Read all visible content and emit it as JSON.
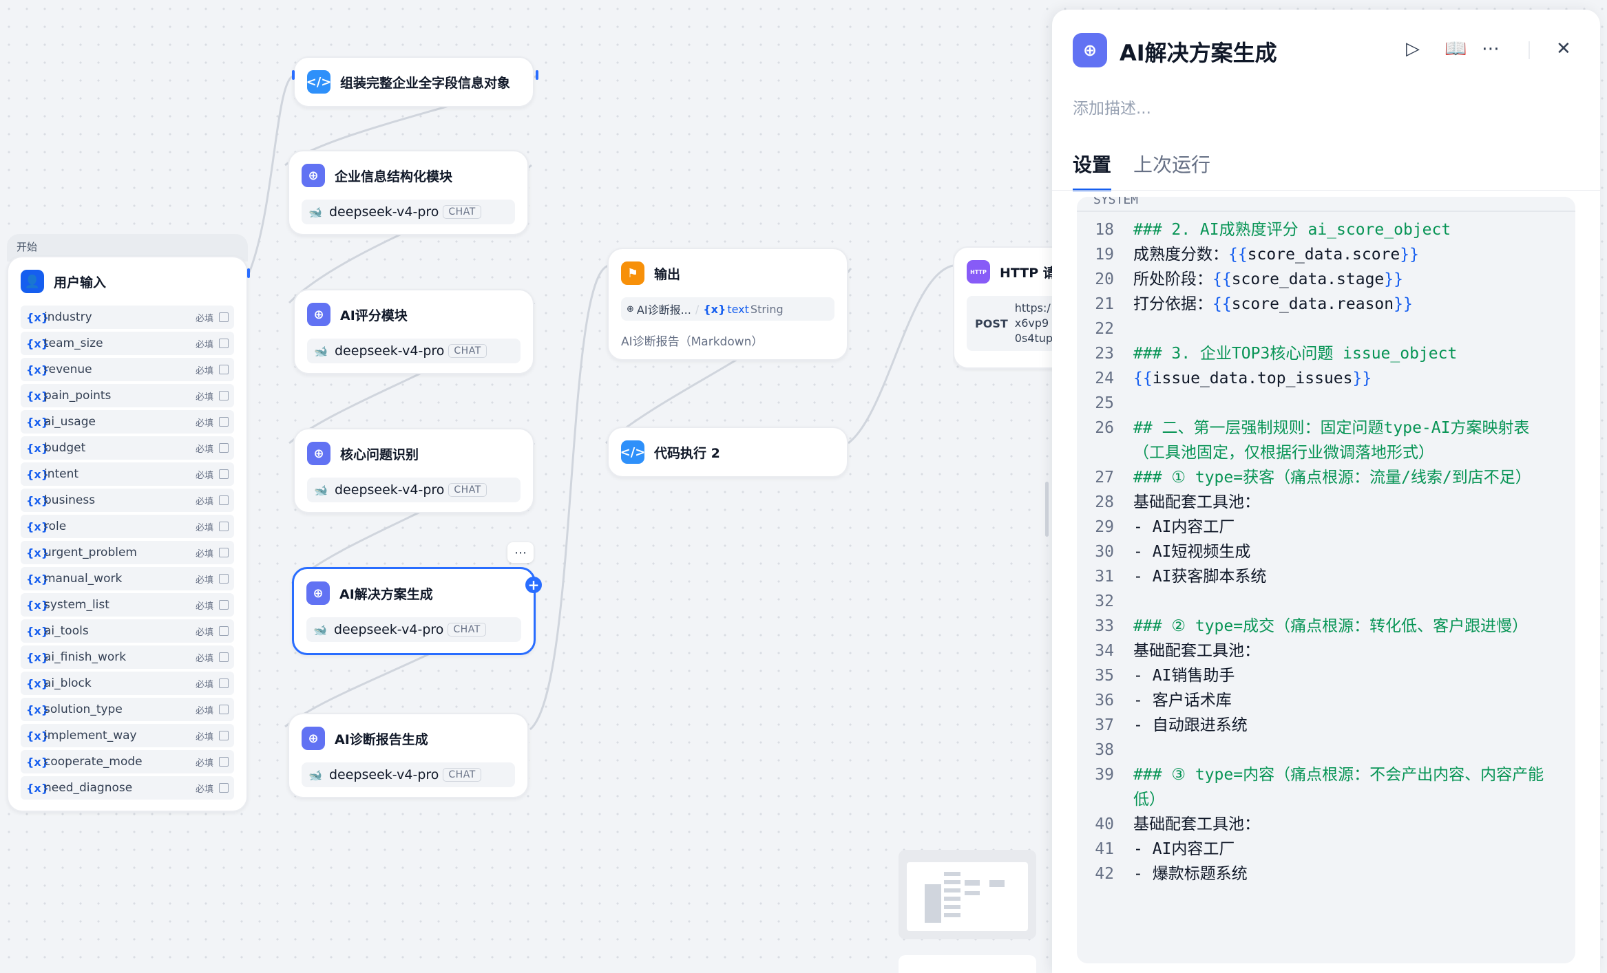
{
  "canvas": {
    "start_node": {
      "group_label": "开始",
      "title": "用户输入",
      "required_label": "必填",
      "variables": [
        "industry",
        "team_size",
        "revenue",
        "pain_points",
        "ai_usage",
        "budget",
        "intent",
        "business",
        "role",
        "urgent_problem",
        "manual_work",
        "system_list",
        "ai_tools",
        "ai_finish_work",
        "ai_block",
        "solution_type",
        "implement_way",
        "cooperate_mode",
        "need_diagnose"
      ]
    },
    "nodes": {
      "assemble": {
        "title": "组装完整企业全字段信息对象"
      },
      "structure": {
        "title": "企业信息结构化模块",
        "model": "deepseek-v4-pro",
        "badge": "CHAT"
      },
      "score": {
        "title": "AI评分模块",
        "model": "deepseek-v4-pro",
        "badge": "CHAT"
      },
      "issue": {
        "title": "核心问题识别",
        "model": "deepseek-v4-pro",
        "badge": "CHAT"
      },
      "solution": {
        "title": "AI解决方案生成",
        "model": "deepseek-v4-pro",
        "badge": "CHAT"
      },
      "report": {
        "title": "AI诊断报告生成",
        "model": "deepseek-v4-pro",
        "badge": "CHAT"
      },
      "output": {
        "title": "输出",
        "var_source": "AI诊断报...",
        "var_name": "text",
        "var_type": "String",
        "desc": "AI诊断报告（Markdown）"
      },
      "code2": {
        "title": "代码执行 2"
      },
      "http": {
        "title": "HTTP 请",
        "method": "POST",
        "url_lines": [
          "https:/",
          "x6vp9",
          "0s4tup"
        ]
      }
    }
  },
  "panel": {
    "title": "AI解决方案生成",
    "description_placeholder": "添加描述...",
    "tabs": [
      "设置",
      "上次运行"
    ],
    "editor_header": "SYSTEM",
    "code_lines": [
      {
        "n": "18",
        "t": "### 2. AI成熟度评分 ai_score_object",
        "k": "heading"
      },
      {
        "n": "19",
        "t": "成熟度分数：{{score_data.score}}",
        "k": "tpl"
      },
      {
        "n": "20",
        "t": "所处阶段：{{score_data.stage}}",
        "k": "tpl"
      },
      {
        "n": "21",
        "t": "打分依据：{{score_data.reason}}",
        "k": "tpl"
      },
      {
        "n": "22",
        "t": "",
        "k": "tpl"
      },
      {
        "n": "23",
        "t": "### 3. 企业TOP3核心问题 issue_object",
        "k": "heading"
      },
      {
        "n": "24",
        "t": "{{issue_data.top_issues}}",
        "k": "tpl"
      },
      {
        "n": "25",
        "t": "",
        "k": "tpl"
      },
      {
        "n": "26",
        "t": "## 二、第一层强制规则：固定问题type-AI方案映射表（工具池固定，仅根据行业微调落地形式）",
        "k": "heading"
      },
      {
        "n": "27",
        "t": "### ① type=获客（痛点根源：流量/线索/到店不足）",
        "k": "heading"
      },
      {
        "n": "28",
        "t": "基础配套工具池：",
        "k": "tpl"
      },
      {
        "n": "29",
        "t": "- AI内容工厂",
        "k": "tpl"
      },
      {
        "n": "30",
        "t": "- AI短视频生成",
        "k": "tpl"
      },
      {
        "n": "31",
        "t": "- AI获客脚本系统",
        "k": "tpl"
      },
      {
        "n": "32",
        "t": "",
        "k": "tpl"
      },
      {
        "n": "33",
        "t": "### ② type=成交（痛点根源：转化低、客户跟进慢）",
        "k": "heading"
      },
      {
        "n": "34",
        "t": "基础配套工具池：",
        "k": "tpl"
      },
      {
        "n": "35",
        "t": "- AI销售助手",
        "k": "tpl"
      },
      {
        "n": "36",
        "t": "- 客户话术库",
        "k": "tpl"
      },
      {
        "n": "37",
        "t": "- 自动跟进系统",
        "k": "tpl"
      },
      {
        "n": "38",
        "t": "",
        "k": "tpl"
      },
      {
        "n": "39",
        "t": "### ③ type=内容（痛点根源：不会产出内容、内容产能低）",
        "k": "heading"
      },
      {
        "n": "40",
        "t": "基础配套工具池：",
        "k": "tpl"
      },
      {
        "n": "41",
        "t": "- AI内容工厂",
        "k": "tpl"
      },
      {
        "n": "42",
        "t": "- 爆款标题系统",
        "k": "tpl"
      }
    ]
  },
  "colors": {
    "accent": "#296dff",
    "llm_icon": "#6172f3",
    "code_icon": "#2e90fa",
    "output_icon": "#f79009",
    "http_icon": "#875bf7",
    "heading_green": "#079455"
  },
  "icons": {
    "llm": "brain-icon",
    "code": "code-icon",
    "output": "flag-icon",
    "http": "http-icon",
    "start": "user-icon",
    "run": "play-icon",
    "docs": "book-icon",
    "more": "ellipsis-icon",
    "close": "close-icon"
  }
}
